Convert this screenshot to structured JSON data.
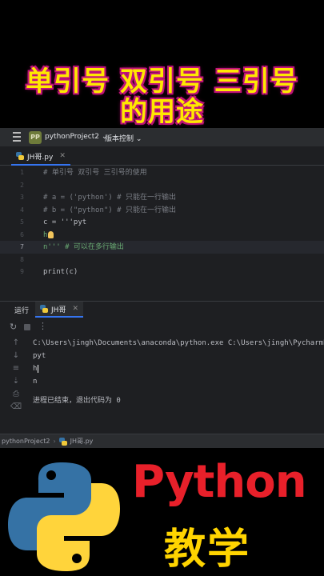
{
  "banner": {
    "title_line1": "单引号 双引号 三引号",
    "title_line2": "的用途"
  },
  "topbar": {
    "project_badge": "PP",
    "project_name": "pythonProject2 ⌄",
    "vcs": "版本控制 ⌄"
  },
  "editor": {
    "tab_label": "JH哥.py",
    "lines": [
      {
        "num": "1",
        "text": "# 单引号 双引号 三引号的使用"
      },
      {
        "num": "2",
        "text": ""
      },
      {
        "num": "3",
        "text": "# a = ('python') # 只能在一行输出"
      },
      {
        "num": "4",
        "text": "# b = (\"python\") # 只能在一行输出"
      },
      {
        "num": "5",
        "text": "c = '''pyt"
      },
      {
        "num": "6",
        "text": "h"
      },
      {
        "num": "7",
        "text": "n''' # 可以在多行输出"
      },
      {
        "num": "8",
        "text": ""
      },
      {
        "num": "9",
        "text": "print(c)"
      }
    ]
  },
  "run_panel": {
    "run_label": "运行",
    "tab_label": "JH哥",
    "console_lines": [
      "C:\\Users\\jingh\\Documents\\anaconda\\python.exe C:\\Users\\jingh\\PycharmP",
      "pyt",
      "h",
      "n",
      "进程已结束，退出代码为 0"
    ]
  },
  "statusbar": {
    "project": "pythonProject2",
    "file": "JH哥.py"
  },
  "promo": {
    "python_text": "Python",
    "teaching_text": "教学"
  },
  "colors": {
    "banner_yellow": "#ffe800",
    "banner_glow": "#c0147a",
    "python_red": "#e8202a",
    "teaching_yellow": "#ffd400",
    "logo_blue": "#3572a5",
    "logo_yellow": "#ffd43b"
  }
}
